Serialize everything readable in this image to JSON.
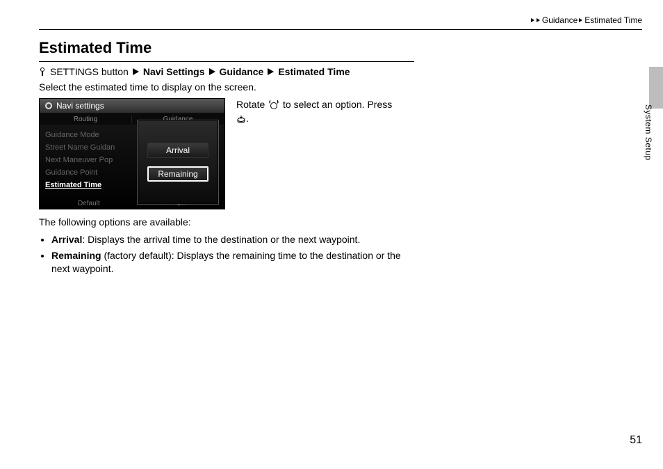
{
  "breadcrumb": {
    "item1": "Guidance",
    "item2": "Estimated Time"
  },
  "title": "Estimated Time",
  "navpath": {
    "prefix": "SETTINGS button",
    "s1": "Navi Settings",
    "s2": "Guidance",
    "s3": "Estimated Time"
  },
  "lead": "Select the estimated time to display on the screen.",
  "instruction": {
    "part1": "Rotate ",
    "part2": " to select an option. Press ",
    "part3": "."
  },
  "screenshot": {
    "header": "Navi settings",
    "tab1": "Routing",
    "tab2": "Guidance",
    "items": {
      "i0": "Guidance Mode",
      "i1": "Street Name Guidan",
      "i2": "Next Maneuver Pop",
      "i3": "Guidance Point",
      "i4": "Estimated Time"
    },
    "footer_left": "Default",
    "footer_right": "OK",
    "popup": {
      "opt1": "Arrival",
      "opt2": "Remaining"
    }
  },
  "sub": "The following options are available:",
  "options": {
    "o1_label": "Arrival",
    "o1_text": ": Displays the arrival time to the destination or the next waypoint.",
    "o2_label": "Remaining",
    "o2_note": " (factory default): Displays the remaining time to the destination or the next waypoint."
  },
  "side_label": "System Setup",
  "page_number": "51"
}
